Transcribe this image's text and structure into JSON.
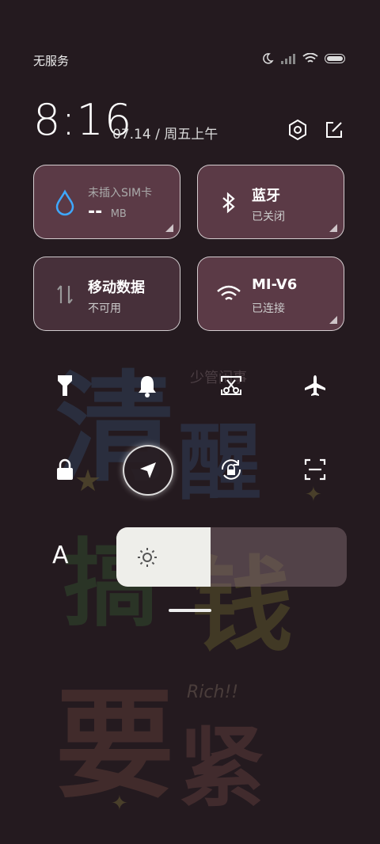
{
  "status_bar": {
    "carrier": "无服务",
    "icons": [
      "moon-icon",
      "signal-icon",
      "wifi-icon",
      "battery-icon"
    ]
  },
  "header": {
    "time": "8:16",
    "date": "07.14 / 周五上午",
    "icons": [
      "settings-icon",
      "edit-icon"
    ]
  },
  "tiles": [
    {
      "id": "data-usage",
      "title": "未插入SIM卡",
      "value": "--",
      "unit": "MB",
      "icon": "water-drop-icon"
    },
    {
      "id": "bluetooth",
      "title": "蓝牙",
      "subtitle": "已关闭",
      "icon": "bluetooth-icon"
    },
    {
      "id": "mobile-data",
      "title": "移动数据",
      "subtitle": "不可用",
      "icon": "mobile-data-icon"
    },
    {
      "id": "wifi",
      "title": "MI-V6",
      "subtitle": "已连接",
      "icon": "wifi-icon"
    }
  ],
  "quick_toggles": [
    {
      "name": "flashlight",
      "icon": "flashlight-icon",
      "active": false
    },
    {
      "name": "silent",
      "icon": "bell-icon",
      "active": false
    },
    {
      "name": "screenshot",
      "icon": "screenshot-icon",
      "active": false
    },
    {
      "name": "airplane",
      "icon": "airplane-icon",
      "active": false
    },
    {
      "name": "lock",
      "icon": "lock-icon",
      "active": false
    },
    {
      "name": "location",
      "icon": "location-icon",
      "active": true
    },
    {
      "name": "auto-rotate",
      "icon": "rotate-lock-icon",
      "active": false
    },
    {
      "name": "scan",
      "icon": "scan-icon",
      "active": false
    }
  ],
  "brightness": {
    "auto_label": "A",
    "level": 0.41
  },
  "wallpaper": {
    "text": [
      "清",
      "醒",
      "搞",
      "钱",
      "要",
      "紧"
    ],
    "small_text": "少管闲事",
    "signature": "Rich!!"
  }
}
